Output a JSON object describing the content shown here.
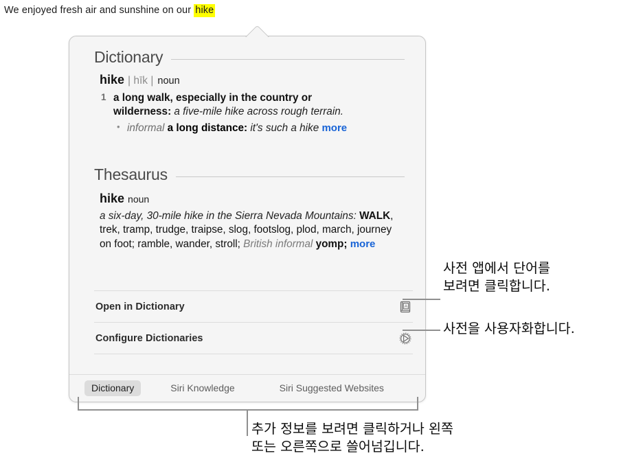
{
  "sentence": {
    "before": "We enjoyed fresh air and sunshine on our ",
    "highlighted_word": "hike",
    "highlight_color": "#ffff00"
  },
  "popup": {
    "dictionary": {
      "heading": "Dictionary",
      "headword": "hike",
      "pronunciation": "| hīk |",
      "part_of_speech": "noun",
      "senses": [
        {
          "number": "1",
          "definition": "a long walk, especially in the country or wilderness:",
          "example": "a five-mile hike across rough terrain."
        }
      ],
      "subsenses": [
        {
          "bullet": "•",
          "label": "informal",
          "definition": "a long distance:",
          "example": "it's such a hike",
          "more_label": "more"
        }
      ]
    },
    "thesaurus": {
      "heading": "Thesaurus",
      "headword": "hike",
      "part_of_speech": "noun",
      "example": "a six-day, 30-mile hike in the Sierra Nevada Mountains:",
      "synonyms_primary": "WALK",
      "synonyms": ", trek, tramp, trudge, traipse, slog, footslog, plod, march, journey on foot; ramble, wander, stroll; ",
      "register_label": "British informal",
      "register_synonym": " yomp; ",
      "more_label": "more"
    },
    "actions": [
      {
        "label": "Open in Dictionary",
        "icon": "dictionary-book-icon"
      },
      {
        "label": "Configure Dictionaries",
        "icon": "gear-icon"
      }
    ],
    "tabs": [
      {
        "label": "Dictionary",
        "active": true
      },
      {
        "label": "Siri Knowledge",
        "active": false
      },
      {
        "label": "Siri Suggested Websites",
        "active": false
      }
    ]
  },
  "callouts": {
    "open_in_dictionary": {
      "line1": "사전 앱에서 단어를",
      "line2": "보려면 클릭합니다."
    },
    "configure_dictionaries": {
      "line1": "사전을 사용자화합니다."
    },
    "tabs": {
      "line1": "추가 정보를 보려면 클릭하거나 왼쪽",
      "line2": "또는 오른쪽으로 쓸어넘깁니다."
    }
  },
  "colors": {
    "link": "#1763d6",
    "popup_bg": "#f5f5f5",
    "popup_border": "#c6c6c6",
    "tab_active_bg": "#dcdcdc",
    "callout_line": "#8f8f8f"
  }
}
